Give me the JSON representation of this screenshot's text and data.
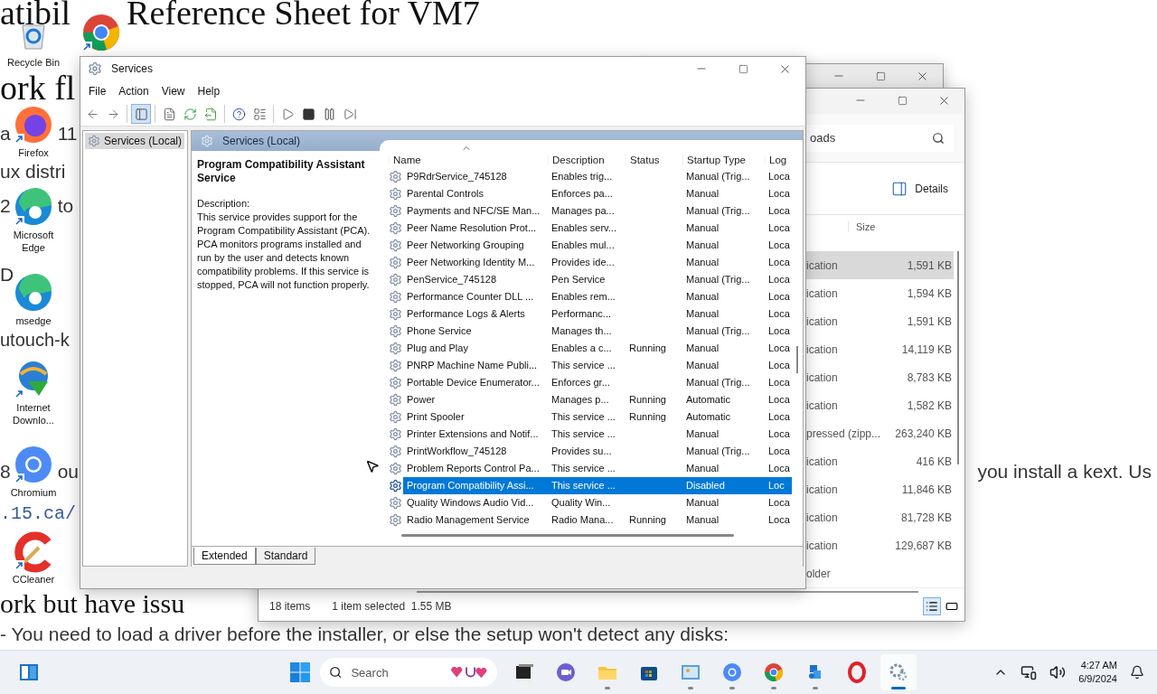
{
  "web_page": {
    "lines": [
      {
        "kind": "heading",
        "segments": [
          "atibil",
          "Reference Sheet for VM7"
        ]
      },
      {
        "kind": "heading",
        "segments": [
          "ork fl"
        ]
      },
      {
        "kind": "text",
        "segments": [
          "a",
          "11"
        ]
      },
      {
        "kind": "text",
        "segments": [
          "ux distri"
        ]
      },
      {
        "kind": "text",
        "segments": [
          "2",
          "to"
        ]
      },
      {
        "kind": "text",
        "segments": [
          "D"
        ]
      },
      {
        "kind": "text",
        "segments": [
          "utouch-k"
        ]
      },
      {
        "kind": "text",
        "segments": [
          "8",
          "ou"
        ],
        "right_text": "you install a kext. Us"
      },
      {
        "kind": "code",
        "segments": [
          ".15.ca/"
        ]
      },
      {
        "kind": "heading",
        "segments": [
          "ork but have issu"
        ]
      },
      {
        "kind": "text",
        "segments": [
          "- You need to load a driver before the installer, or else the setup won't detect any disks:"
        ]
      }
    ]
  },
  "desktop_icons": [
    {
      "kind": "recycle-bin",
      "label": "Recycle Bin",
      "shortcut": false
    },
    {
      "kind": "chrome",
      "shortcut": true
    },
    {
      "kind": "firefox",
      "label": "Firefox",
      "shortcut": true
    },
    {
      "kind": "edge",
      "label": "Microsoft Edge",
      "shortcut": true
    },
    {
      "kind": "edge",
      "label": "msedge",
      "shortcut": false
    },
    {
      "kind": "downloader",
      "label": "Internet Downlo...",
      "shortcut": true
    },
    {
      "kind": "chromium",
      "label": "Chromium",
      "shortcut": true
    },
    {
      "kind": "ccleaner",
      "label": "CCleaner",
      "shortcut": true
    }
  ],
  "explorer": {
    "search": {
      "placeholder": "oads"
    },
    "details_button": "Details",
    "size_column": "Size",
    "rows": [
      {
        "type": "ication",
        "size": "1,591 KB",
        "selected": true
      },
      {
        "type": "ication",
        "size": "1,594 KB",
        "selected": false
      },
      {
        "type": "ication",
        "size": "1,591 KB",
        "selected": false
      },
      {
        "type": "ication",
        "size": "14,119 KB",
        "selected": false
      },
      {
        "type": "ication",
        "size": "8,783 KB",
        "selected": false
      },
      {
        "type": "ication",
        "size": "1,582 KB",
        "selected": false
      },
      {
        "type": "pressed (zipp...",
        "size": "263,240 KB",
        "selected": false
      },
      {
        "type": "ication",
        "size": "416 KB",
        "selected": false
      },
      {
        "type": "ication",
        "size": "11,846 KB",
        "selected": false
      },
      {
        "type": "ication",
        "size": "81,728 KB",
        "selected": false
      },
      {
        "type": "ication",
        "size": "129,687 KB",
        "selected": false
      },
      {
        "type": "older",
        "selected": false
      }
    ],
    "status_bar": {
      "items": "18 items",
      "selection": "1 item selected  1.55 MB"
    },
    "views": [
      {
        "kind": "details",
        "selected": true
      },
      {
        "kind": "tiles",
        "selected": false
      }
    ]
  },
  "services_window": {
    "title": "Services",
    "menu": [
      "File",
      "Action",
      "View",
      "Help"
    ],
    "toolbar": [
      {
        "kind": "back",
        "pressed": false
      },
      {
        "kind": "forward",
        "pressed": false
      },
      {
        "kind": "sep"
      },
      {
        "kind": "tree",
        "pressed": true
      },
      {
        "kind": "sep"
      },
      {
        "kind": "properties",
        "pressed": false
      },
      {
        "kind": "refresh",
        "pressed": false
      },
      {
        "kind": "export",
        "pressed": false
      },
      {
        "kind": "sep"
      },
      {
        "kind": "help",
        "pressed": false
      },
      {
        "kind": "view",
        "pressed": false
      },
      {
        "kind": "sep"
      },
      {
        "kind": "start",
        "pressed": false
      },
      {
        "kind": "stop",
        "pressed": false
      },
      {
        "kind": "pause",
        "pressed": false
      },
      {
        "kind": "resume",
        "pressed": false
      }
    ],
    "tree": [
      {
        "label": "Services (Local)",
        "selected": true
      }
    ],
    "pane_title": "Services (Local)",
    "detail": {
      "title": "Program Compatibility Assistant Service",
      "description_label": "Description:",
      "description": "This service provides support for the Program Compatibility Assistant (PCA).  PCA monitors programs installed and run by the user and detects known compatibility problems. If this service is stopped, PCA will not function properly."
    },
    "columns": [
      "Name",
      "Description",
      "Status",
      "Startup Type",
      "Log"
    ],
    "rows": [
      {
        "name": "P9RdrService_745128",
        "description": "Enables trig...",
        "status": "",
        "startup": "Manual (Trig...",
        "log": "Loca",
        "selected": false
      },
      {
        "name": "Parental Controls",
        "description": "Enforces pa...",
        "status": "",
        "startup": "Manual",
        "log": "Loca",
        "selected": false
      },
      {
        "name": "Payments and NFC/SE Man...",
        "description": "Manages pa...",
        "status": "",
        "startup": "Manual (Trig...",
        "log": "Loca",
        "selected": false
      },
      {
        "name": "Peer Name Resolution Prot...",
        "description": "Enables serv...",
        "status": "",
        "startup": "Manual",
        "log": "Loca",
        "selected": false
      },
      {
        "name": "Peer Networking Grouping",
        "description": "Enables mul...",
        "status": "",
        "startup": "Manual",
        "log": "Loca",
        "selected": false
      },
      {
        "name": "Peer Networking Identity M...",
        "description": "Provides ide...",
        "status": "",
        "startup": "Manual",
        "log": "Loca",
        "selected": false
      },
      {
        "name": "PenService_745128",
        "description": "Pen Service",
        "status": "",
        "startup": "Manual (Trig...",
        "log": "Loca",
        "selected": false
      },
      {
        "name": "Performance Counter DLL ...",
        "description": "Enables rem...",
        "status": "",
        "startup": "Manual",
        "log": "Loca",
        "selected": false
      },
      {
        "name": "Performance Logs & Alerts",
        "description": "Performanc...",
        "status": "",
        "startup": "Manual",
        "log": "Loca",
        "selected": false
      },
      {
        "name": "Phone Service",
        "description": "Manages th...",
        "status": "",
        "startup": "Manual (Trig...",
        "log": "Loca",
        "selected": false
      },
      {
        "name": "Plug and Play",
        "description": "Enables a c...",
        "status": "Running",
        "startup": "Manual",
        "log": "Loca",
        "selected": false
      },
      {
        "name": "PNRP Machine Name Publi...",
        "description": "This service ...",
        "status": "",
        "startup": "Manual",
        "log": "Loca",
        "selected": false
      },
      {
        "name": "Portable Device Enumerator...",
        "description": "Enforces gr...",
        "status": "",
        "startup": "Manual (Trig...",
        "log": "Loca",
        "selected": false
      },
      {
        "name": "Power",
        "description": "Manages p...",
        "status": "Running",
        "startup": "Automatic",
        "log": "Loca",
        "selected": false
      },
      {
        "name": "Print Spooler",
        "description": "This service ...",
        "status": "Running",
        "startup": "Automatic",
        "log": "Loca",
        "selected": false
      },
      {
        "name": "Printer Extensions and Notif...",
        "description": "This service ...",
        "status": "",
        "startup": "Manual",
        "log": "Loca",
        "selected": false
      },
      {
        "name": "PrintWorkflow_745128",
        "description": "Provides su...",
        "status": "",
        "startup": "Manual (Trig...",
        "log": "Loca",
        "selected": false
      },
      {
        "name": "Problem Reports Control Pa...",
        "description": "This service ...",
        "status": "",
        "startup": "Manual",
        "log": "Loca",
        "selected": false
      },
      {
        "name": "Program Compatibility Assi...",
        "description": "This service ...",
        "status": "",
        "startup": "Disabled",
        "log": "Loc",
        "selected": true
      },
      {
        "name": "Quality Windows Audio Vid...",
        "description": "Quality Win...",
        "status": "",
        "startup": "Manual",
        "log": "Loca",
        "selected": false
      },
      {
        "name": "Radio Management Service",
        "description": "Radio Mana...",
        "status": "Running",
        "startup": "Manual",
        "log": "Loca",
        "selected": false
      }
    ],
    "tabs": [
      {
        "label": "Extended",
        "selected": true
      },
      {
        "label": "Standard",
        "selected": false
      }
    ]
  },
  "taskbar": {
    "search": {
      "placeholder": "Search"
    },
    "apps": [
      {
        "kind": "task-view",
        "running": false,
        "active": false
      },
      {
        "kind": "meet",
        "running": false,
        "active": false
      },
      {
        "kind": "folder",
        "running": true,
        "active": false
      },
      {
        "kind": "store",
        "running": false,
        "active": false
      },
      {
        "kind": "photos",
        "running": true,
        "active": false
      },
      {
        "kind": "chromium",
        "running": true,
        "active": false
      },
      {
        "kind": "chrome",
        "running": true,
        "active": false
      },
      {
        "kind": "puzzle",
        "running": true,
        "active": false
      },
      {
        "kind": "opera",
        "running": false,
        "active": false
      },
      {
        "kind": "services",
        "running": true,
        "active": true
      }
    ],
    "time": "4:27 AM",
    "date": "6/9/2024"
  }
}
